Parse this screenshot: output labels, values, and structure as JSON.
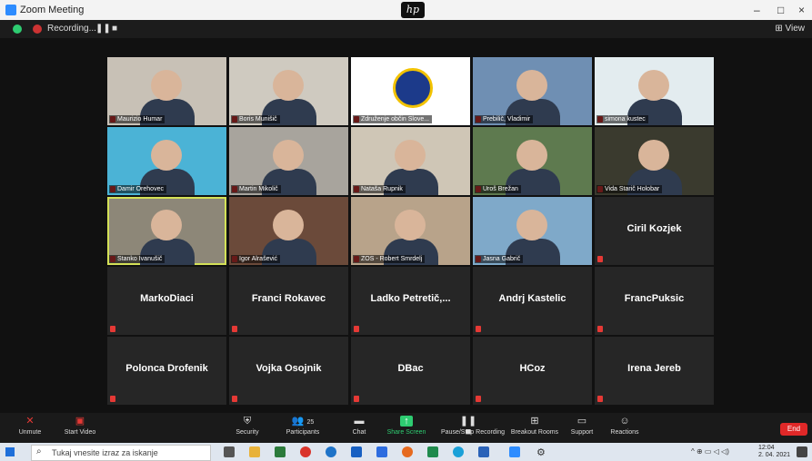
{
  "window": {
    "title": "Zoom Meeting",
    "brand": "hp",
    "minimize": "–",
    "maximize": "□",
    "close": "×"
  },
  "meeting": {
    "recording_label": "Recording...",
    "pause": "❚❚",
    "stop": "■",
    "view_label": "View"
  },
  "participants": [
    {
      "name": "Maurizio Humar",
      "video": true,
      "bg": "#c8c1b6"
    },
    {
      "name": "Boris Munišič",
      "video": true,
      "bg": "#cfcac0"
    },
    {
      "name": "Združenje občin Slove...",
      "video": true,
      "bg": "#ffffff",
      "logo": true
    },
    {
      "name": "Prebilič, Vladimir",
      "video": true,
      "bg": "#6f8fb3"
    },
    {
      "name": "simona kustec",
      "video": true,
      "bg": "#e3ecef"
    },
    {
      "name": "Damir Orehovec",
      "video": true,
      "bg": "#4bb3d6"
    },
    {
      "name": "Martin Mikolič",
      "video": true,
      "bg": "#a8a49d"
    },
    {
      "name": "Nataša Rupnik",
      "video": true,
      "bg": "#cfc6b6"
    },
    {
      "name": "Uroš Brežan",
      "video": true,
      "bg": "#5e7a4f"
    },
    {
      "name": "Vida Starič Holobar",
      "video": true,
      "bg": "#3a3a2e"
    },
    {
      "name": "Stanko Ivanušič",
      "video": true,
      "bg": "#8d8778",
      "speaking": true
    },
    {
      "name": "Igor Alrašević",
      "video": true,
      "bg": "#6b4a3a"
    },
    {
      "name": "ZOS - Robert Smrdelj",
      "video": true,
      "bg": "#b8a38a"
    },
    {
      "name": "Jasna Gabrič",
      "video": true,
      "bg": "#7fa9c9"
    },
    {
      "name": "Ciril Kozjek",
      "video": false
    },
    {
      "name": "MarkoDiaci",
      "video": false
    },
    {
      "name": "Franci Rokavec",
      "video": false
    },
    {
      "name": "Ladko Petretič,...",
      "video": false
    },
    {
      "name": "Andrj Kastelic",
      "video": false
    },
    {
      "name": "FrancPuksic",
      "video": false
    },
    {
      "name": "Polonca Drofenik",
      "video": false
    },
    {
      "name": "Vojka Osojnik",
      "video": false
    },
    {
      "name": "DBac",
      "video": false
    },
    {
      "name": "HCoz",
      "video": false
    },
    {
      "name": "Irena Jereb",
      "video": false
    }
  ],
  "toolbar": {
    "unmute": "Unmute",
    "start_video": "Start Video",
    "security": "Security",
    "participants": "Participants",
    "participants_count": "25",
    "chat": "Chat",
    "share_screen": "Share Screen",
    "pause_stop": "Pause/Stop Recording",
    "breakout": "Breakout Rooms",
    "support": "Support",
    "reactions": "Reactions",
    "end": "End"
  },
  "taskbar": {
    "search_placeholder": "Tukaj vnesite izraz za iskanje",
    "time": "12:04",
    "date": "2. 04. 2021",
    "tray": "^ ⊕ ▭ ◁ ◁)"
  },
  "colors": {
    "accent_green": "#2ecc71",
    "end_red": "#e02828",
    "speaking_outline": "#d4e157"
  }
}
